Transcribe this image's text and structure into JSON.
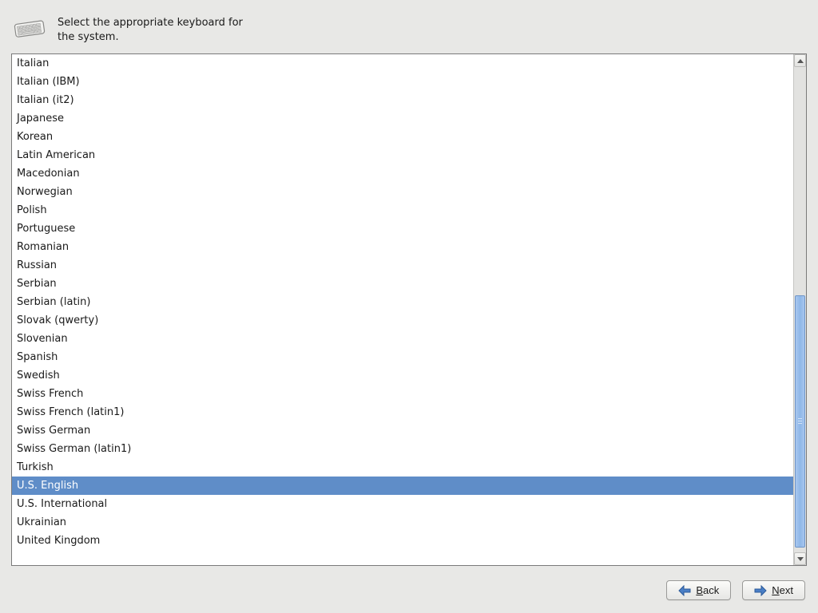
{
  "header": {
    "prompt": "Select the appropriate keyboard for the system."
  },
  "keyboard_list": {
    "selected": "U.S. English",
    "items": [
      "Italian",
      "Italian (IBM)",
      "Italian (it2)",
      "Japanese",
      "Korean",
      "Latin American",
      "Macedonian",
      "Norwegian",
      "Polish",
      "Portuguese",
      "Romanian",
      "Russian",
      "Serbian",
      "Serbian (latin)",
      "Slovak (qwerty)",
      "Slovenian",
      "Spanish",
      "Swedish",
      "Swiss French",
      "Swiss French (latin1)",
      "Swiss German",
      "Swiss German (latin1)",
      "Turkish",
      "U.S. English",
      "U.S. International",
      "Ukrainian",
      "United Kingdom"
    ]
  },
  "footer": {
    "back_label": "Back",
    "back_mnemonic": "B",
    "next_label": "Next",
    "next_mnemonic": "N"
  },
  "colors": {
    "selection": "#5f8dc8",
    "back_arrow": "#4a7fc6",
    "next_arrow": "#4a7fc6",
    "bg": "#e8e8e6"
  }
}
